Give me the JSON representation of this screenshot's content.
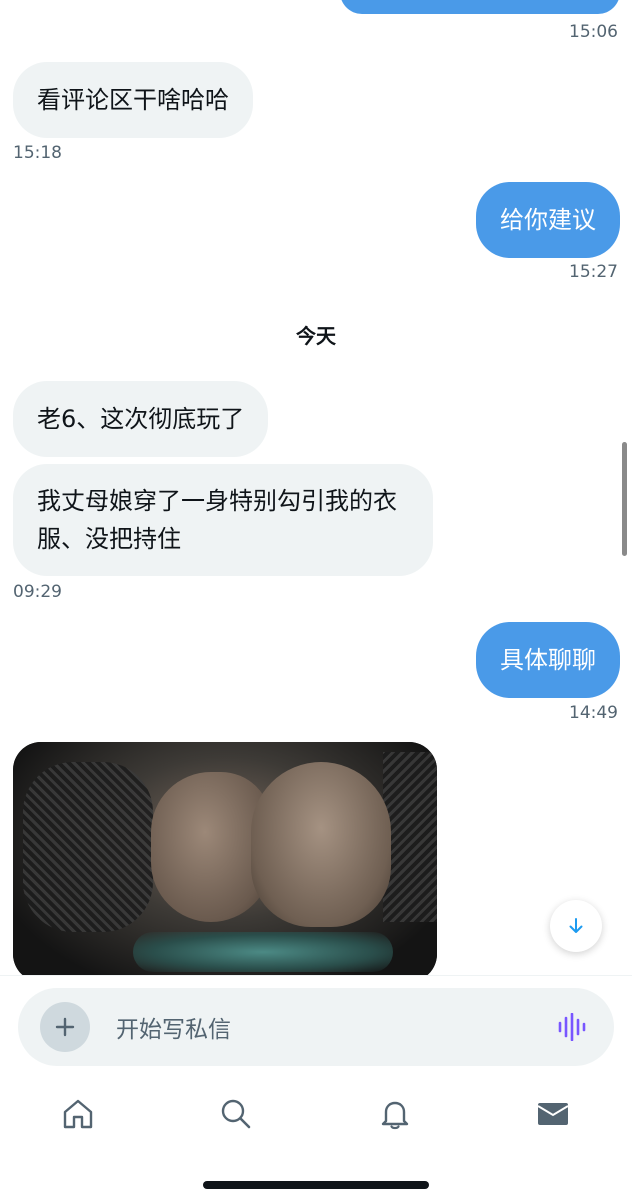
{
  "messages": [
    {
      "text": "看评论区干啥哈哈",
      "direction": "in"
    },
    {
      "text": "给你建议",
      "direction": "out"
    },
    {
      "text": "老6、这次彻底玩了",
      "direction": "in"
    },
    {
      "text": "我丈母娘穿了一身特别勾引我的衣服、没把持住",
      "direction": "in"
    },
    {
      "text": "具体聊聊",
      "direction": "out"
    }
  ],
  "timestamps": [
    "15:06",
    "15:18",
    "15:27",
    "09:29",
    "14:49"
  ],
  "day_divider": "今天",
  "composer": {
    "placeholder": "开始写私信"
  },
  "tabbar": {
    "icons": [
      "home-icon",
      "search-icon",
      "bell-icon",
      "mail-icon"
    ]
  },
  "colors": {
    "outgoing_bubble": "#4a9ae8",
    "incoming_bubble": "#eff3f4",
    "voice_icon": "#7856ff",
    "jump_arrow": "#1d9bf0"
  }
}
